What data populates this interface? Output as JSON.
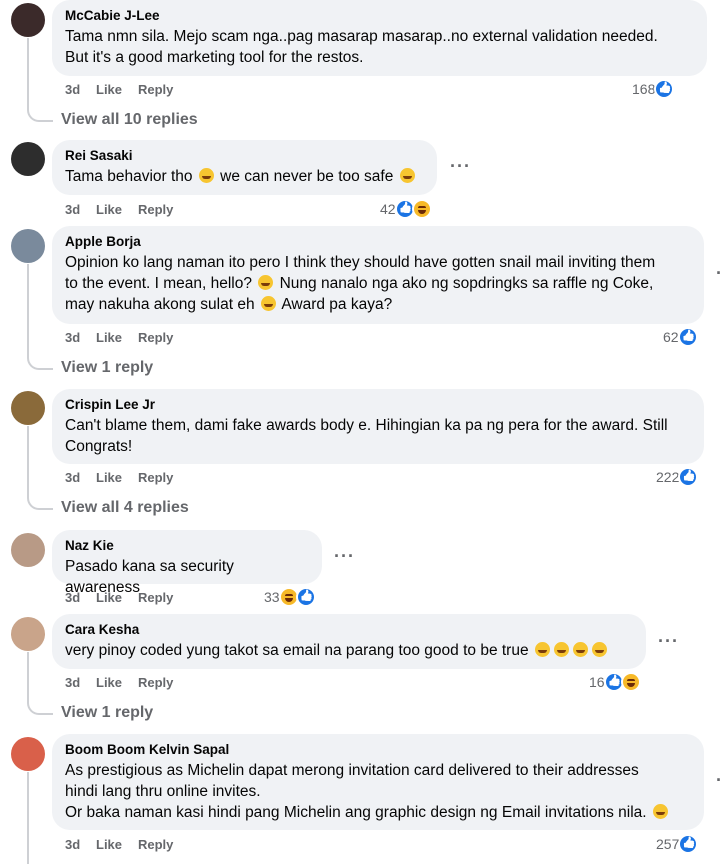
{
  "labels": {
    "like": "Like",
    "reply": "Reply"
  },
  "comments": [
    {
      "name": "McCabie J-Lee",
      "lines": [
        "Tama nmn sila. Mejo scam nga..pag masarap masarap..no external validation needed.",
        "But it's a good marketing tool for the restos."
      ],
      "time": "3d",
      "count": "168",
      "reactions": [
        "like"
      ],
      "view_replies": "View all 10 replies",
      "avatar_color": "#3b2a2a"
    },
    {
      "name": "Rei Sasaki",
      "lines": [
        "Tama behavior tho",
        "we can never be too safe"
      ],
      "time": "3d",
      "count": "42",
      "reactions": [
        "like",
        "haha"
      ],
      "view_replies": "",
      "avatar_color": "#2d2d2d"
    },
    {
      "name": "Apple Borja",
      "lines": [
        "Opinion ko lang naman ito pero I think they should have gotten snail mail inviting them",
        "to the event. I mean, hello?",
        "Nung nanalo nga ako ng sopdringks sa raffle ng Coke,",
        "may nakuha akong sulat eh",
        "Award pa kaya?"
      ],
      "time": "3d",
      "count": "62",
      "reactions": [
        "like"
      ],
      "view_replies": "View 1 reply",
      "avatar_color": "#7a8a9c"
    },
    {
      "name": "Crispin Lee Jr",
      "lines": [
        "Can't blame them, dami fake awards body e. Hihingian ka pa ng pera for the award. Still",
        "Congrats!"
      ],
      "time": "3d",
      "count": "222",
      "reactions": [
        "like"
      ],
      "view_replies": "View all 4 replies",
      "avatar_color": "#8a6a3a"
    },
    {
      "name": "Naz Kie",
      "lines": [
        "Pasado kana sa security awareness"
      ],
      "time": "3d",
      "count": "33",
      "reactions": [
        "haha",
        "like"
      ],
      "view_replies": "",
      "avatar_color": "#b89a86"
    },
    {
      "name": "Cara Kesha",
      "lines": [
        "very pinoy coded yung takot sa email na parang too good to be true"
      ],
      "time": "3d",
      "count": "16",
      "reactions": [
        "like",
        "haha"
      ],
      "view_replies": "View 1 reply",
      "avatar_color": "#c9a48a"
    },
    {
      "name": "Boom Boom Kelvin Sapal",
      "lines": [
        "As prestigious as Michelin dapat merong invitation card delivered to their addresses",
        "hindi lang thru online invites.",
        "Or baka naman kasi hindi pang Michelin ang graphic design ng Email invitations nila."
      ],
      "time": "3d",
      "count": "257",
      "reactions": [
        "like"
      ],
      "view_replies": "",
      "avatar_color": "#d9604a"
    }
  ],
  "colors": {
    "bubble": "#f0f2f5",
    "meta": "#65676b",
    "like_blue": "#1b74e4",
    "haha_yellow": "#f7b928"
  }
}
